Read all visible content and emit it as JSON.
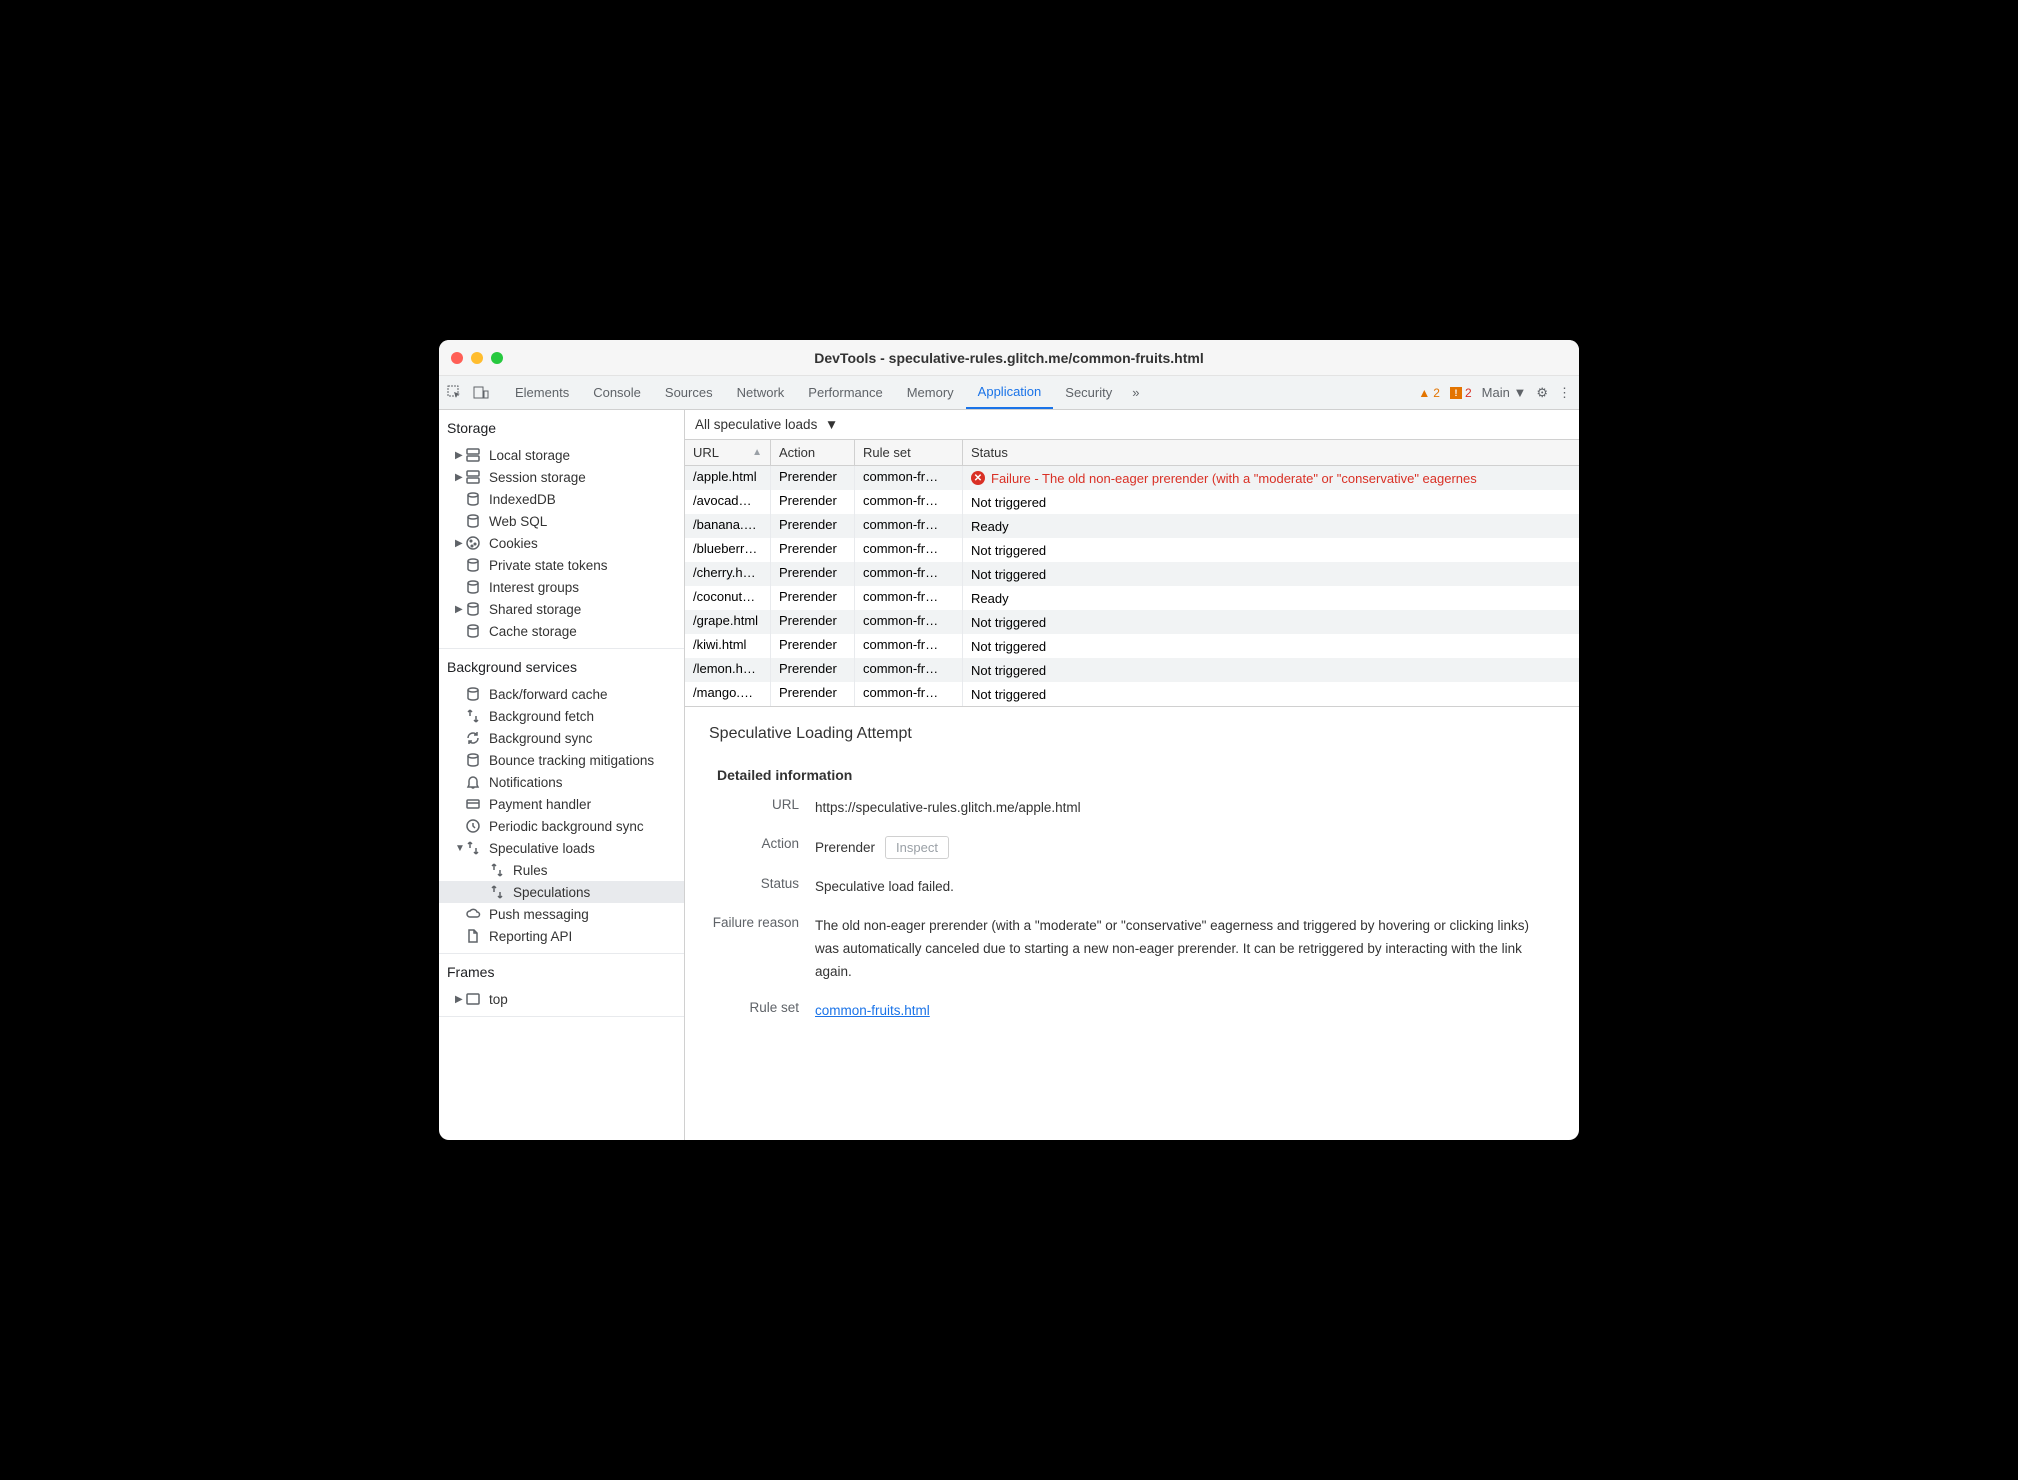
{
  "window": {
    "title": "DevTools - speculative-rules.glitch.me/common-fruits.html"
  },
  "tabs": [
    "Elements",
    "Console",
    "Sources",
    "Network",
    "Performance",
    "Memory",
    "Application",
    "Security"
  ],
  "active_tab": "Application",
  "badges": {
    "warn": "2",
    "err": "2"
  },
  "target_label": "Main",
  "sidebar": {
    "storage": {
      "title": "Storage",
      "items": [
        {
          "label": "Local storage",
          "icon": "db-icon",
          "expand": true
        },
        {
          "label": "Session storage",
          "icon": "db-icon",
          "expand": true
        },
        {
          "label": "IndexedDB",
          "icon": "cylinder-icon"
        },
        {
          "label": "Web SQL",
          "icon": "cylinder-icon"
        },
        {
          "label": "Cookies",
          "icon": "cookie-icon",
          "expand": true
        },
        {
          "label": "Private state tokens",
          "icon": "cylinder-icon"
        },
        {
          "label": "Interest groups",
          "icon": "cylinder-icon"
        },
        {
          "label": "Shared storage",
          "icon": "cylinder-icon",
          "expand": true
        },
        {
          "label": "Cache storage",
          "icon": "cylinder-icon"
        }
      ]
    },
    "bg": {
      "title": "Background services",
      "items": [
        {
          "label": "Back/forward cache",
          "icon": "cylinder-icon"
        },
        {
          "label": "Background fetch",
          "icon": "arrows-icon"
        },
        {
          "label": "Background sync",
          "icon": "sync-icon"
        },
        {
          "label": "Bounce tracking mitigations",
          "icon": "cylinder-icon"
        },
        {
          "label": "Notifications",
          "icon": "bell-icon"
        },
        {
          "label": "Payment handler",
          "icon": "card-icon"
        },
        {
          "label": "Periodic background sync",
          "icon": "clock-icon"
        },
        {
          "label": "Speculative loads",
          "icon": "arrows-icon",
          "expand": true,
          "open": true,
          "children": [
            {
              "label": "Rules",
              "icon": "arrows-icon"
            },
            {
              "label": "Speculations",
              "icon": "arrows-icon",
              "selected": true
            }
          ]
        },
        {
          "label": "Push messaging",
          "icon": "cloud-icon"
        },
        {
          "label": "Reporting API",
          "icon": "file-icon"
        }
      ]
    },
    "frames": {
      "title": "Frames",
      "items": [
        {
          "label": "top",
          "icon": "frame-icon",
          "expand": true
        }
      ]
    }
  },
  "filter": "All speculative loads",
  "columns": {
    "url": "URL",
    "action": "Action",
    "rule": "Rule set",
    "status": "Status"
  },
  "rows": [
    {
      "url": "/apple.html",
      "action": "Prerender",
      "rule": "common-fr…",
      "status": "Failure - The old non-eager prerender (with a \"moderate\" or \"conservative\" eagernes",
      "err": true
    },
    {
      "url": "/avocad…",
      "action": "Prerender",
      "rule": "common-fr…",
      "status": "Not triggered"
    },
    {
      "url": "/banana.…",
      "action": "Prerender",
      "rule": "common-fr…",
      "status": "Ready"
    },
    {
      "url": "/blueberr…",
      "action": "Prerender",
      "rule": "common-fr…",
      "status": "Not triggered"
    },
    {
      "url": "/cherry.h…",
      "action": "Prerender",
      "rule": "common-fr…",
      "status": "Not triggered"
    },
    {
      "url": "/coconut…",
      "action": "Prerender",
      "rule": "common-fr…",
      "status": "Ready"
    },
    {
      "url": "/grape.html",
      "action": "Prerender",
      "rule": "common-fr…",
      "status": "Not triggered"
    },
    {
      "url": "/kiwi.html",
      "action": "Prerender",
      "rule": "common-fr…",
      "status": "Not triggered"
    },
    {
      "url": "/lemon.h…",
      "action": "Prerender",
      "rule": "common-fr…",
      "status": "Not triggered"
    },
    {
      "url": "/mango.…",
      "action": "Prerender",
      "rule": "common-fr…",
      "status": "Not triggered"
    }
  ],
  "detail": {
    "heading": "Speculative Loading Attempt",
    "subheading": "Detailed information",
    "url_label": "URL",
    "url": "https://speculative-rules.glitch.me/apple.html",
    "action_label": "Action",
    "action": "Prerender",
    "inspect": "Inspect",
    "status_label": "Status",
    "status": "Speculative load failed.",
    "reason_label": "Failure reason",
    "reason": "The old non-eager prerender (with a \"moderate\" or \"conservative\" eagerness and triggered by hovering or clicking links) was automatically canceled due to starting a new non-eager prerender. It can be retriggered by interacting with the link again.",
    "ruleset_label": "Rule set",
    "ruleset": "common-fruits.html"
  }
}
